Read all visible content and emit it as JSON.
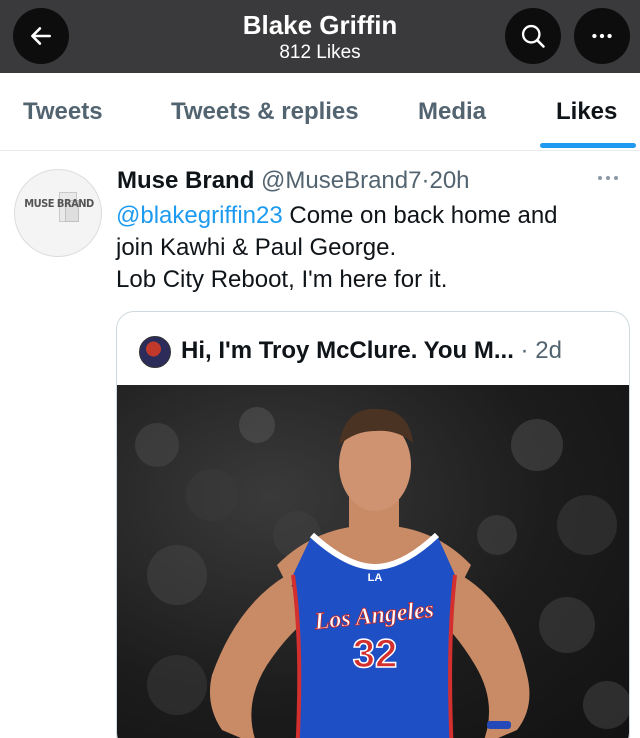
{
  "header": {
    "title": "Blake Griffin",
    "subtitle": "812 Likes",
    "icons": {
      "back": "arrow-left-icon",
      "search": "search-icon",
      "more": "more-horizontal-icon"
    }
  },
  "tabs": [
    {
      "label": "Tweets",
      "active": false
    },
    {
      "label": "Tweets & replies",
      "active": false
    },
    {
      "label": "Media",
      "active": false
    },
    {
      "label": "Likes",
      "active": true
    }
  ],
  "tweet": {
    "author_name": "Muse Brand",
    "author_handle": "@MuseBrand7",
    "separator": "·",
    "time": "20h",
    "avatar_text": "MUSE BRAND",
    "body": {
      "mention": "@blakegriffin23",
      "line1_rest": " Come on back home and",
      "line2": "join Kawhi & Paul George.",
      "line3": "Lob City Reboot, I'm here for it."
    },
    "quote": {
      "author_name": "Hi, I'm Troy McClure. You M...",
      "separator": "·",
      "time": "2d",
      "jersey_logo": "LA",
      "jersey_team": "Los Angeles",
      "jersey_number": "32"
    }
  },
  "colors": {
    "header_bg": "#3a3a3c",
    "accent": "#1d9bf0",
    "secondary_text": "#536471",
    "jersey_blue": "#1f4fc4"
  }
}
